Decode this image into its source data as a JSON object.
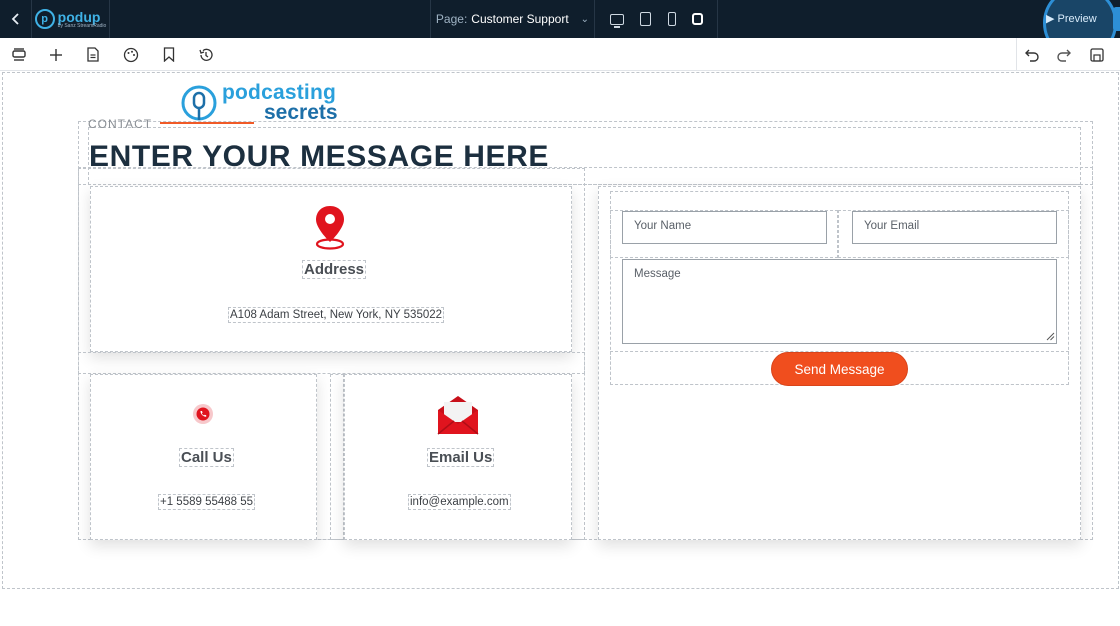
{
  "topbar": {
    "page_label": "Page:",
    "page_name": "Customer Support",
    "preview_label": "Preview",
    "logo_main": "podup",
    "logo_sub": "by Sanz StreamRadio"
  },
  "brand": {
    "line1": "podcasting",
    "line2": "secrets"
  },
  "section": {
    "kicker": "CONTACT",
    "headline": "ENTER YOUR MESSAGE HERE"
  },
  "address": {
    "title": "Address",
    "value": "A108 Adam Street, New York, NY 535022"
  },
  "call": {
    "title": "Call Us",
    "value": "+1 5589 55488 55"
  },
  "email": {
    "title": "Email Us",
    "value": "info@example.com"
  },
  "form": {
    "name_placeholder": "Your Name",
    "email_placeholder": "Your Email",
    "message_placeholder": "Message",
    "send_label": "Send Message"
  },
  "colors": {
    "topbar": "#0f1e2c",
    "accent": "#f04e1e",
    "brand_blue": "#2aa0dc",
    "headline": "#1c2f3f",
    "pin_red": "#e0141e"
  }
}
